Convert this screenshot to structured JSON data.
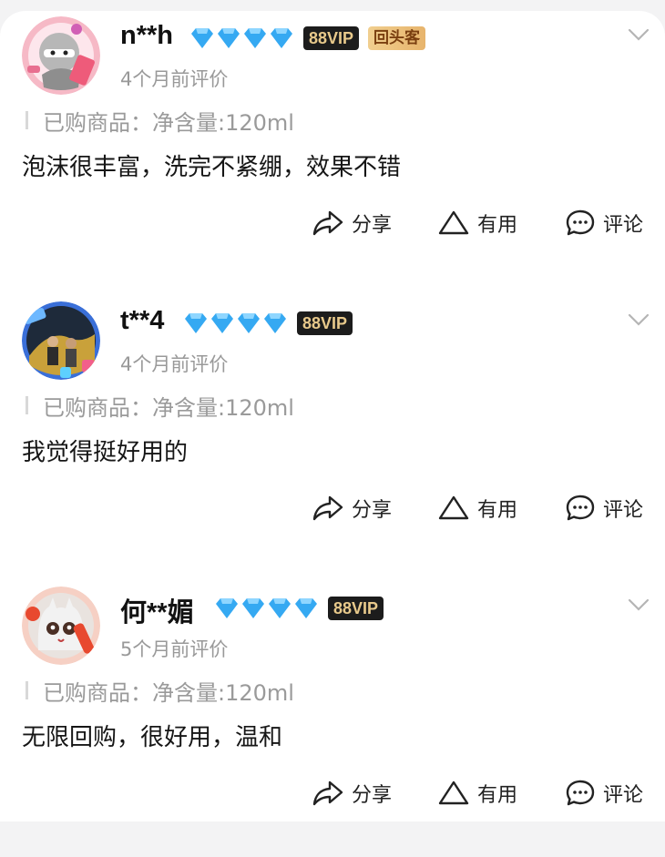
{
  "reviews": [
    {
      "name": "n**h",
      "vip_badge": "88VIP",
      "repeat_badge": "回头客",
      "time": "4个月前评价",
      "product_label": "已购商品：",
      "product_value": "净含量:120ml",
      "content": "泡沫很丰富，洗完不紧绷，效果不错",
      "diamond_level": 4,
      "avatar_icon": "ninja-avatar"
    },
    {
      "name": "t**4",
      "vip_badge": "88VIP",
      "time": "4个月前评价",
      "product_label": "已购商品：",
      "product_value": "净含量:120ml",
      "content": "我觉得挺好用的",
      "diamond_level": 4,
      "avatar_icon": "photo-avatar"
    },
    {
      "name": "何**媚",
      "vip_badge": "88VIP",
      "time": "5个月前评价",
      "product_label": "已购商品：",
      "product_value": "净含量:120ml",
      "content": "无限回购，很好用，温和",
      "diamond_level": 4,
      "avatar_icon": "cat-avatar"
    }
  ],
  "actions": {
    "share": "分享",
    "useful": "有用",
    "comment": "评论"
  },
  "colors": {
    "diamond": "#35a9f2",
    "vip_bg": "#1c1c1c",
    "vip_text": "#e8c98b",
    "muted_text": "#999999"
  }
}
